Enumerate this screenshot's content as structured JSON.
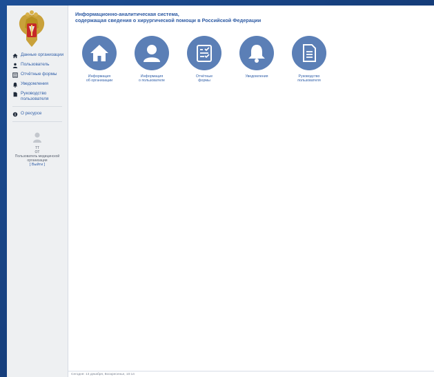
{
  "header": {
    "title_line1": "Информационно-аналитическая система,",
    "title_line2": "содержащая сведения о хирургической помощи в Российской Федерации"
  },
  "sidebar": {
    "items": [
      {
        "label": "Данные организации",
        "icon": "home-icon"
      },
      {
        "label": "Пользователь",
        "icon": "user-icon"
      },
      {
        "label": "Отчётные формы",
        "icon": "list-icon"
      },
      {
        "label": "Уведомления",
        "icon": "bell-icon"
      },
      {
        "label": "Руководство пользователя",
        "icon": "document-icon"
      }
    ],
    "about": {
      "label": "О ресурсе",
      "icon": "info-icon"
    }
  },
  "user": {
    "name": "ТТ",
    "org": "ОТ",
    "role": "Пользователь медицинской организации",
    "logout": "[ Выйти ]"
  },
  "tiles": [
    {
      "label": "Информация\nоб организации",
      "icon": "home-icon"
    },
    {
      "label": "Информация\nо пользователе",
      "icon": "user-icon"
    },
    {
      "label": "Отчётные\nформы",
      "icon": "checklist-icon"
    },
    {
      "label": "Уведомления",
      "icon": "bell-icon"
    },
    {
      "label": "Руководство\nпользователя",
      "icon": "document-icon"
    }
  ],
  "footer": {
    "date_text": "Сегодня: 13 декабря, Воскресенье, 10:14"
  },
  "colors": {
    "accent": "#5b7fb6",
    "link": "#2f5ea8",
    "sidebar_bg": "#eef0f2",
    "desktop_bg": "#1a4788"
  }
}
